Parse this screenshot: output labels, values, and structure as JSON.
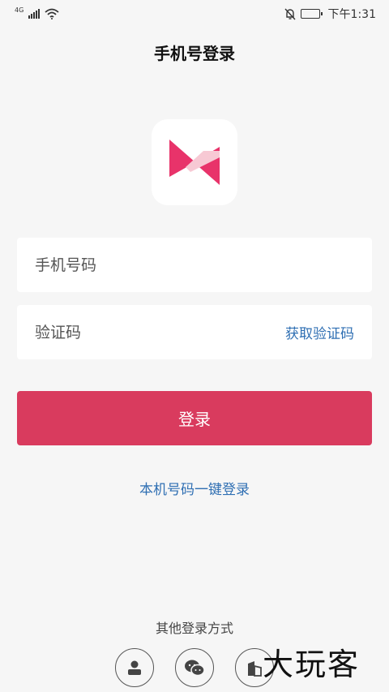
{
  "status_bar": {
    "network": "4G",
    "time": "下午1:31"
  },
  "header": {
    "title": "手机号登录"
  },
  "app_logo": {
    "icon": "bow-play-logo-icon",
    "colors": {
      "primary": "#e8336a",
      "secondary": "#f28aa5"
    }
  },
  "form": {
    "phone_placeholder": "手机号码",
    "code_placeholder": "验证码",
    "get_code_label": "获取验证码",
    "login_button_label": "登录"
  },
  "links": {
    "onekey_login": "本机号码一键登录"
  },
  "other_login": {
    "label": "其他登录方式",
    "methods": [
      "user-account-icon",
      "wechat-icon",
      "building-icon"
    ]
  },
  "watermark": {
    "text": "大玩客"
  },
  "colors": {
    "accent": "#d93b5e",
    "link": "#2f6fb3",
    "background": "#f6f6f6"
  }
}
